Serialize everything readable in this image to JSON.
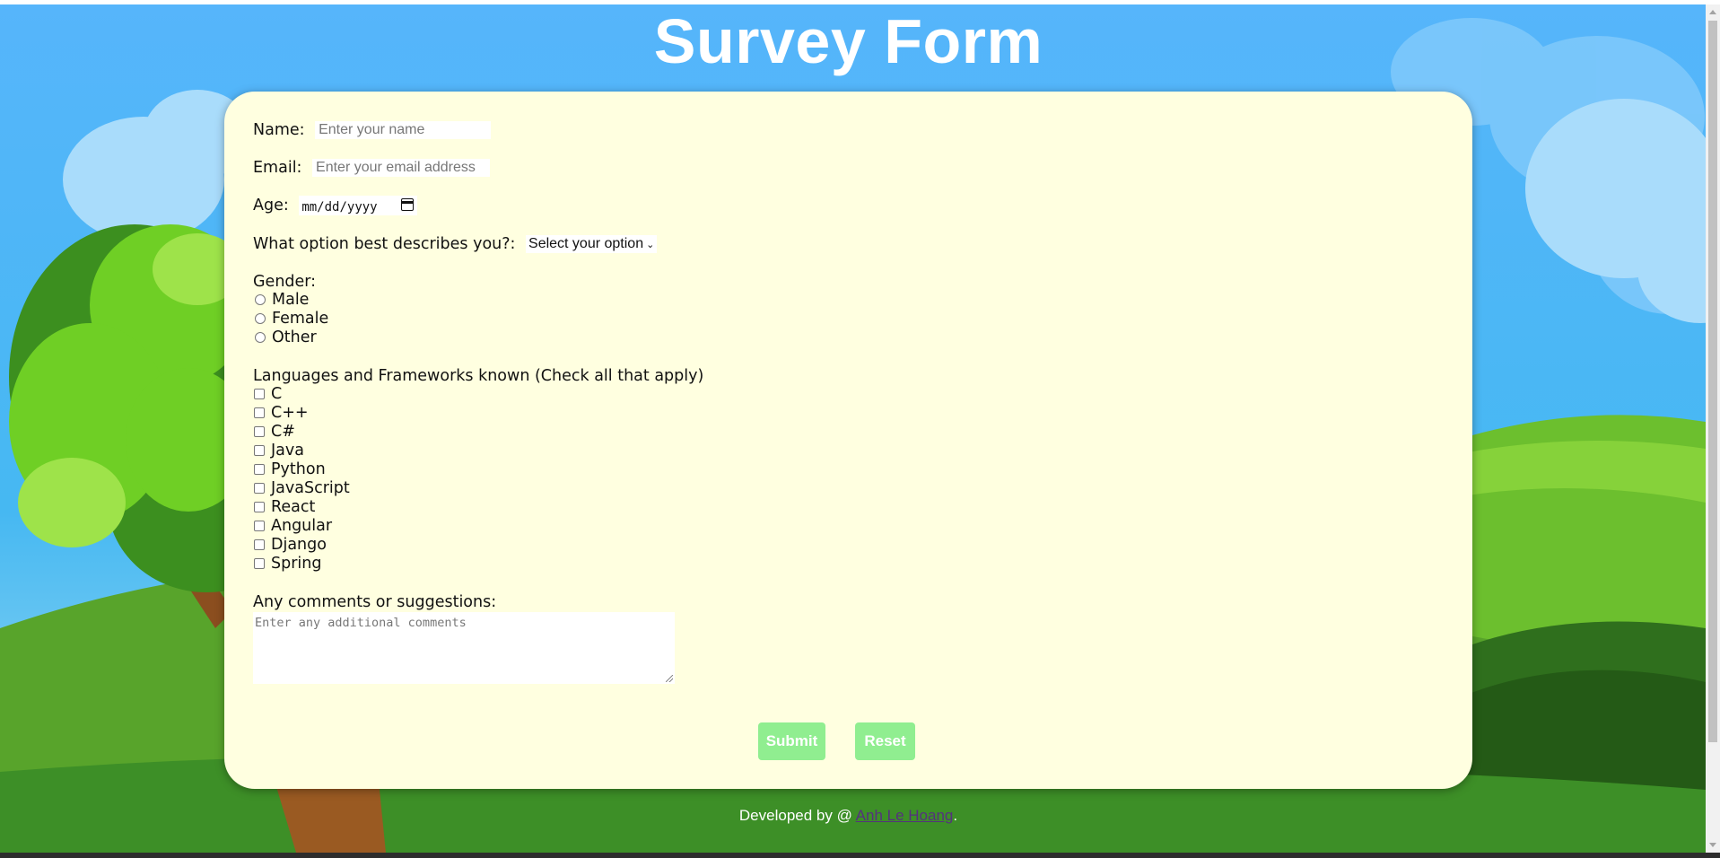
{
  "page": {
    "title": "Survey Form",
    "colors": {
      "sky": "#4fb3f6",
      "card": "#ffffe0",
      "button": "#90ee90"
    }
  },
  "form": {
    "name": {
      "label": "Name:",
      "placeholder": "Enter your name"
    },
    "email": {
      "label": "Email:",
      "placeholder": "Enter your email address"
    },
    "age": {
      "label": "Age:",
      "value": "mm/dd/yyyy",
      "icon": "calendar-icon"
    },
    "role": {
      "label": "What option best describes you?:",
      "selected": "Select your option"
    },
    "gender": {
      "label": "Gender:",
      "options": [
        "Male",
        "Female",
        "Other"
      ]
    },
    "languages": {
      "label": "Languages and Frameworks known (Check all that apply)",
      "options": [
        "C",
        "C++",
        "C#",
        "Java",
        "Python",
        "JavaScript",
        "React",
        "Angular",
        "Django",
        "Spring"
      ]
    },
    "comments": {
      "label": "Any comments or suggestions:",
      "placeholder": "Enter any additional comments"
    },
    "buttons": {
      "submit": "Submit",
      "reset": "Reset"
    }
  },
  "footer": {
    "prefix": "Developed by @",
    "author": "Anh Le Hoang",
    "suffix": "."
  }
}
